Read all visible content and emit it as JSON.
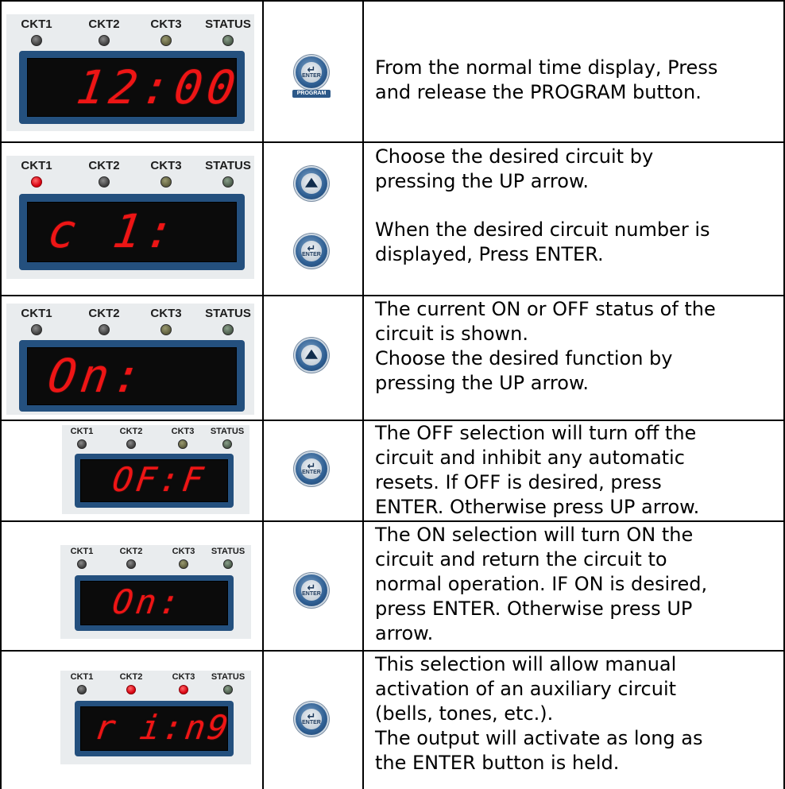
{
  "panel_labels": {
    "ckt1": "CKT1",
    "ckt2": "CKT2",
    "ckt3": "CKT3",
    "status": "STATUS"
  },
  "buttons": {
    "enter_label": "ENTER",
    "program_label": "PROGRAM"
  },
  "steps": [
    {
      "display": "12:00",
      "leds": [
        "off",
        "off",
        "off",
        "off"
      ],
      "buttons": [
        "enter-program"
      ],
      "text": "From the normal time display, Press\nand release the PROGRAM button."
    },
    {
      "display": "c 1:",
      "leds": [
        "on",
        "off",
        "off",
        "off"
      ],
      "buttons": [
        "up",
        "enter"
      ],
      "text": "Choose the desired circuit by\npressing the UP arrow.",
      "text2": "When the desired circuit number is\ndisplayed, Press ENTER."
    },
    {
      "display": "On:",
      "leds": [
        "off",
        "off",
        "off",
        "off"
      ],
      "buttons": [
        "up"
      ],
      "text": "The current ON or OFF status of the\ncircuit is shown.\nChoose the desired function by\npressing the UP arrow."
    },
    {
      "display": "OF:F",
      "leds": [
        "off",
        "off",
        "off",
        "off"
      ],
      "buttons": [
        "enter"
      ],
      "text": "The OFF selection will turn off the\ncircuit and inhibit any automatic\nresets.  If OFF is desired, press\nENTER.  Otherwise press UP arrow."
    },
    {
      "display": "On:",
      "leds": [
        "off",
        "off",
        "off",
        "off"
      ],
      "buttons": [
        "enter"
      ],
      "text": "The ON selection will turn ON the\ncircuit and return the circuit to\nnormal operation.  IF ON is desired,\npress ENTER.  Otherwise press UP\narrow."
    },
    {
      "display": "r i:n9",
      "leds": [
        "off",
        "on",
        "on",
        "off"
      ],
      "buttons": [
        "enter"
      ],
      "text": "This selection will allow manual\nactivation of an auxiliary circuit\n(bells, tones, etc.).\nThe output will activate as long as\nthe ENTER button is held."
    }
  ]
}
